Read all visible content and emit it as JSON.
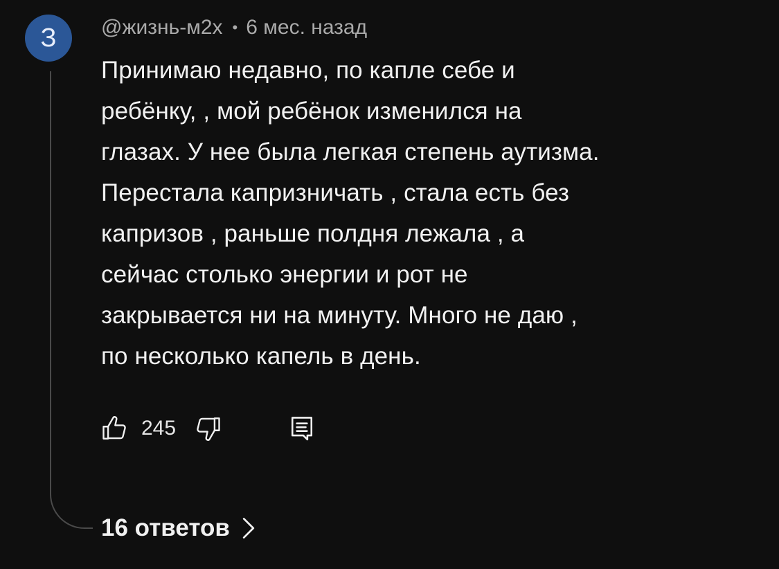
{
  "comment": {
    "avatar_letter": "З",
    "avatar_color": "#2b5797",
    "author": "@жизнь-м2х",
    "separator": "•",
    "time": "6 мес. назад",
    "body_lines": [
      "Принимаю недавно, по капле себе и",
      "ребёнку, , мой ребёнок изменился на",
      "глазах. У нее была легкая степень аутизма.",
      "Перестала капризничать , стала есть без",
      "капризов , раньше полдня лежала , а",
      "сейчас столько энергии и рот не",
      "закрывается ни на минуту. Много не даю ,",
      "по несколько капель в день."
    ],
    "likes": "245",
    "icons": {
      "like": "thumbs-up-icon",
      "dislike": "thumbs-down-icon",
      "reply": "comment-reply-icon",
      "chevron": "chevron-right-icon"
    },
    "replies_label": "16 ответов"
  },
  "colors": {
    "background": "#0f0f0f",
    "text_primary": "#f1f1f1",
    "text_secondary": "#aaaaaa",
    "thread_line": "#4a4a4a"
  }
}
